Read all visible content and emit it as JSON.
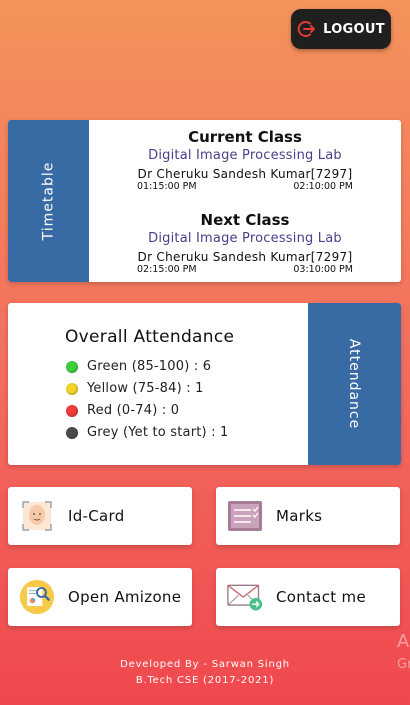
{
  "header": {
    "logout_label": "LOGOUT"
  },
  "timetable": {
    "side_label": "Timetable",
    "current": {
      "heading": "Current Class",
      "subject": "Digital Image Processing Lab",
      "teacher": "Dr Cheruku Sandesh Kumar[7297]",
      "start": "01:15:00 PM",
      "end": "02:10:00 PM"
    },
    "next": {
      "heading": "Next Class",
      "subject": "Digital Image Processing Lab",
      "teacher": "Dr Cheruku Sandesh Kumar[7297]",
      "start": "02:15:00 PM",
      "end": "03:10:00 PM"
    }
  },
  "attendance": {
    "side_label": "Attendance",
    "title": "Overall Attendance",
    "rows": [
      {
        "label": "Green (85-100) : 6",
        "color": "#3bcf3b"
      },
      {
        "label": "Yellow (75-84) : 1",
        "color": "#f2d32c"
      },
      {
        "label": "Red (0-74) : 0",
        "color": "#ee3b3b"
      },
      {
        "label": "Grey (Yet to start) : 1",
        "color": "#4a4a4a"
      }
    ]
  },
  "buttons": {
    "idcard": {
      "label": "Id-Card",
      "icon": "id-card-icon"
    },
    "marks": {
      "label": "Marks",
      "icon": "marks-icon"
    },
    "amizone": {
      "label": "Open Amizone",
      "icon": "amizone-icon"
    },
    "contact": {
      "label": "Contact me",
      "icon": "mail-icon"
    }
  },
  "footer": {
    "line1": "Developed By - Sarwan Singh",
    "line2": "B.Tech CSE (2017-2021)"
  },
  "corner_text": {
    "line1": "A",
    "line2": "Gr"
  }
}
